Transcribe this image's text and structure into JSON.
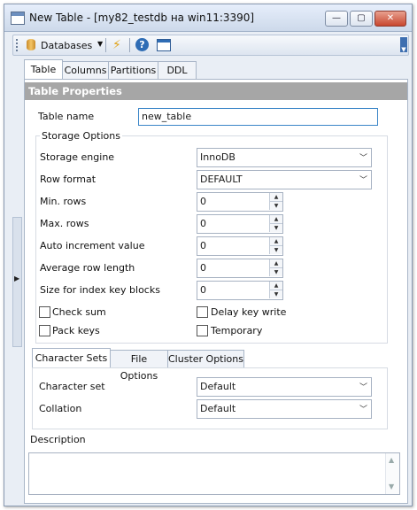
{
  "window": {
    "title": "New Table - [my82_testdb на win11:3390]"
  },
  "toolbar": {
    "databases_label": "Databases"
  },
  "tabs": [
    "Table",
    "Columns",
    "Partitions",
    "DDL"
  ],
  "section": {
    "title": "Table Properties"
  },
  "table_name": {
    "label": "Table name",
    "value": "new_table"
  },
  "storage": {
    "title": "Storage Options",
    "engine": {
      "label": "Storage engine",
      "value": "InnoDB"
    },
    "row_format": {
      "label": "Row format",
      "value": "DEFAULT"
    },
    "min_rows": {
      "label": "Min. rows",
      "value": "0"
    },
    "max_rows": {
      "label": "Max. rows",
      "value": "0"
    },
    "auto_increment": {
      "label": "Auto increment value",
      "value": "0"
    },
    "avg_row_length": {
      "label": "Average row length",
      "value": "0"
    },
    "key_block_size": {
      "label": "Size for index key blocks",
      "value": "0"
    },
    "checks": {
      "checksum": {
        "label": "Check sum",
        "checked": false
      },
      "delay_key_write": {
        "label": "Delay key write",
        "checked": false
      },
      "pack_keys": {
        "label": "Pack keys",
        "checked": false
      },
      "temporary": {
        "label": "Temporary",
        "checked": false
      }
    }
  },
  "subtabs": [
    "Character Sets",
    "File Options",
    "Cluster Options"
  ],
  "charset": {
    "character_set": {
      "label": "Character set",
      "value": "Default"
    },
    "collation": {
      "label": "Collation",
      "value": "Default"
    }
  },
  "description": {
    "label": "Description",
    "value": ""
  },
  "icons": [
    "table-icon",
    "minimize-icon",
    "maximize-icon",
    "close-icon",
    "database-icon",
    "dropdown-arrow-icon",
    "lightning-icon",
    "help-icon",
    "window-icon",
    "toolbar-overflow-icon",
    "sidebar-toggle-icon"
  ]
}
